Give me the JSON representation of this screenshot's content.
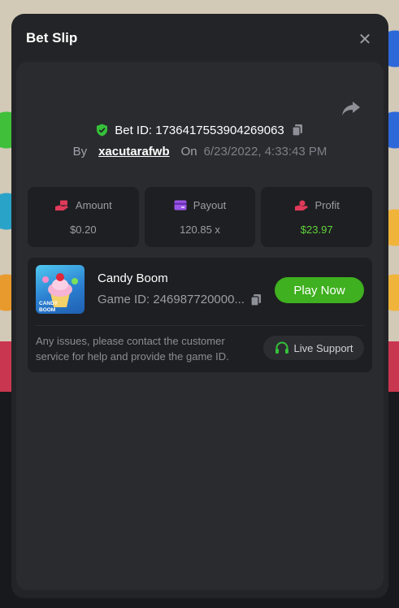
{
  "modal": {
    "title": "Bet Slip",
    "close_icon": "close-icon",
    "share_icon": "share-icon"
  },
  "bet": {
    "id_label": "Bet ID: 1736417553904269063",
    "by_label": "By",
    "username": "xacutarafwb",
    "on_label": "On",
    "datetime": "6/23/2022, 4:33:43 PM"
  },
  "stats": {
    "amount": {
      "label": "Amount",
      "value": "$0.20",
      "icon": "cash-hand-icon"
    },
    "payout": {
      "label": "Payout",
      "value": "120.85 x",
      "icon": "card-icon"
    },
    "profit": {
      "label": "Profit",
      "value": "$23.97",
      "icon": "profit-hand-icon"
    }
  },
  "game": {
    "name": "Candy Boom",
    "id_label": "Game ID: 246987720000...",
    "thumb_text": "CANDY BOOM",
    "play_label": "Play Now"
  },
  "support": {
    "text": "Any issues, please contact the customer service for help and provide the game ID.",
    "button_label": "Live Support"
  },
  "colors": {
    "accent_green": "#3fb01f",
    "profit_green": "#5fd33a",
    "shield_green": "#35c13a"
  }
}
